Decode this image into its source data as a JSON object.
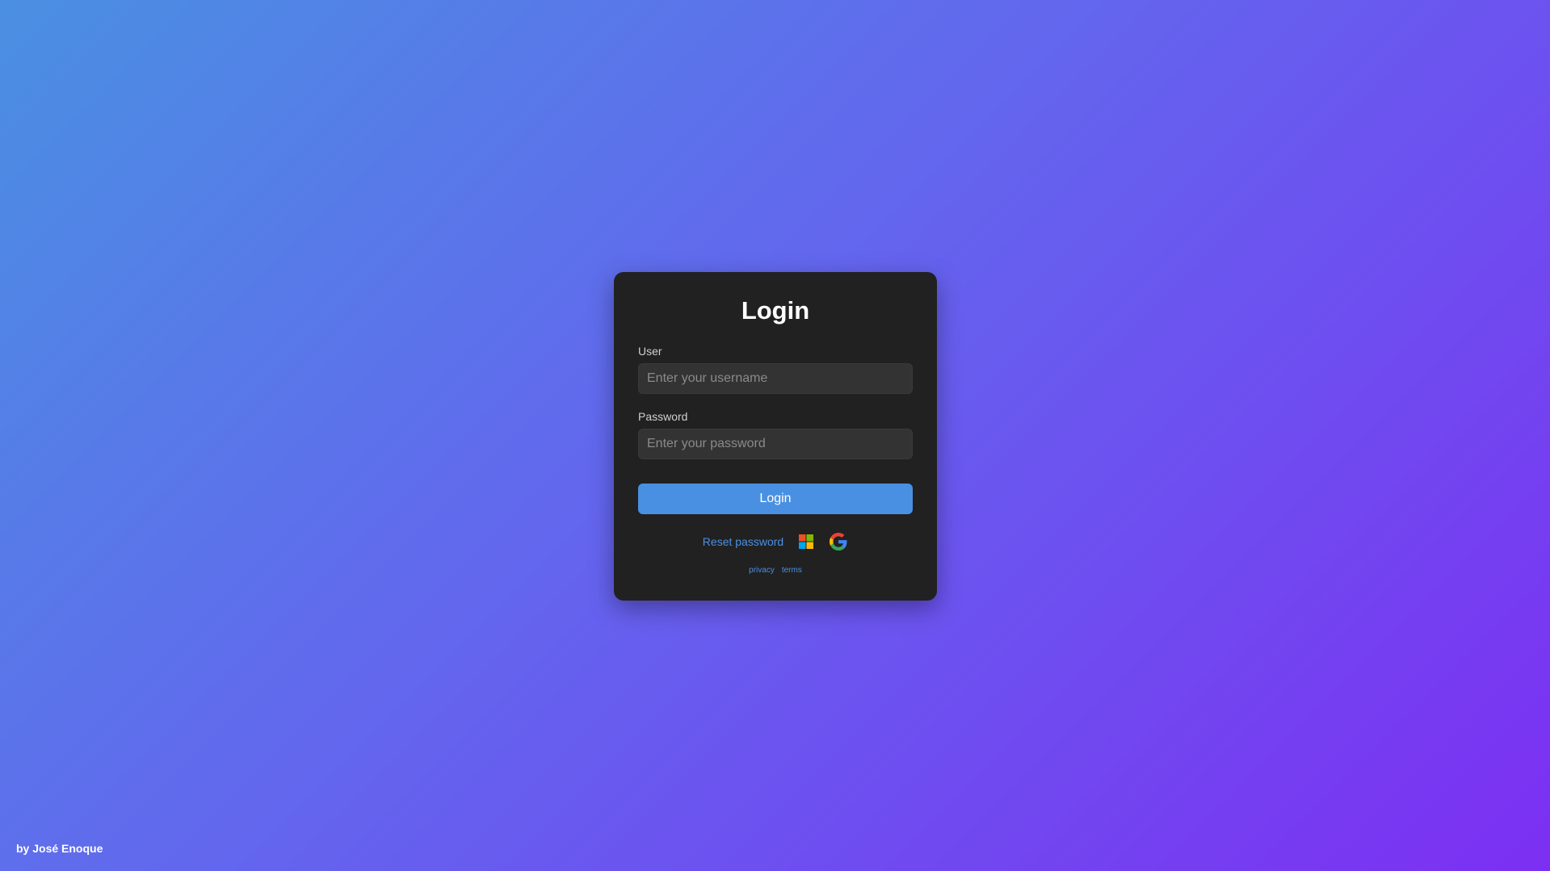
{
  "login_card": {
    "title": "Login",
    "user_label": "User",
    "user_placeholder": "Enter your username",
    "password_label": "Password",
    "password_placeholder": "Enter your password",
    "login_button_label": "Login",
    "reset_password_label": "Reset password",
    "social_icons": [
      "microsoft-icon",
      "google-icon"
    ],
    "privacy_label": "privacy",
    "terms_label": "terms"
  },
  "footer": {
    "credit": "by José Enoque"
  },
  "colors": {
    "gradient_start": "#4a90e2",
    "gradient_end": "#7c2ff2",
    "card_background": "#212121",
    "input_background": "#333333",
    "accent": "#4a90e2",
    "microsoft_red": "#f25022",
    "microsoft_green": "#7fba00",
    "microsoft_blue": "#00a4ef",
    "microsoft_yellow": "#ffb900",
    "google_blue": "#4285f4",
    "google_red": "#ea4335",
    "google_yellow": "#fbbc05",
    "google_green": "#34a853"
  }
}
